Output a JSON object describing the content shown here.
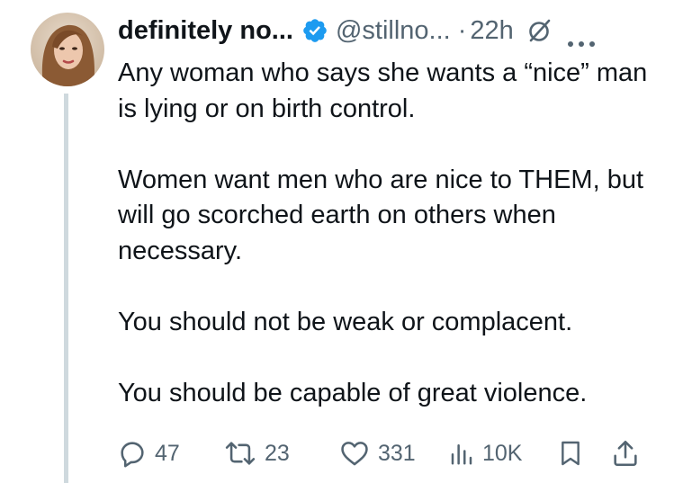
{
  "tweet": {
    "display_name": "definitely no...",
    "handle": "@stillno...",
    "separator": "·",
    "time": "22h",
    "body": [
      "Any woman who says she wants a “nice” man is lying or on birth control.",
      "Women want men who are nice to THEM, but will go scorched earth on others when necessary.",
      "You should not be weak or complacent.",
      "You should be capable of great violence."
    ]
  },
  "actions": {
    "replies": "47",
    "reposts": "23",
    "likes": "331",
    "views": "10K"
  },
  "icons": {
    "verified": "verified-badge-icon",
    "grok": "grok-icon",
    "more": "more-icon",
    "reply": "reply-icon",
    "repost": "repost-icon",
    "like": "heart-icon",
    "views": "views-icon",
    "bookmark": "bookmark-icon",
    "share": "share-icon"
  },
  "colors": {
    "text": "#0f1419",
    "secondary": "#536471",
    "verified": "#1d9bf0",
    "thread_line": "#cfd9de"
  }
}
